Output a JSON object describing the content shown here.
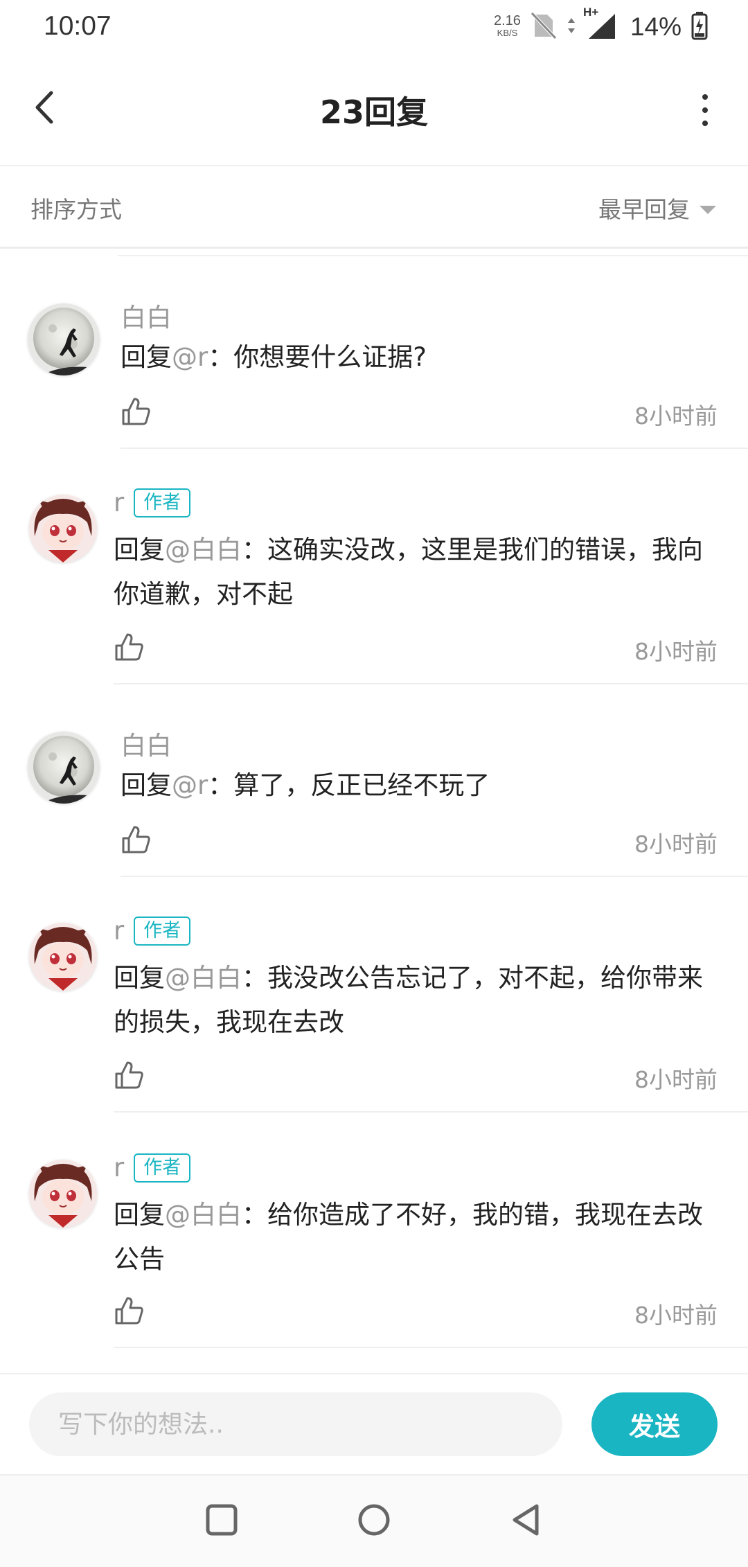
{
  "status_bar": {
    "time": "10:07",
    "net_speed_value": "2.16",
    "net_speed_unit": "KB/S",
    "network_type": "H+",
    "battery_percent": "14%"
  },
  "header": {
    "title": "23回复"
  },
  "sort": {
    "label": "排序方式",
    "selected": "最早回复"
  },
  "replies": [
    {
      "name": "白白",
      "is_author": false,
      "badge": "",
      "reply_prefix": "回复",
      "mention": "@r",
      "text": "：你想要什么证据?",
      "time": "8小时前"
    },
    {
      "name": "r",
      "is_author": true,
      "badge": "作者",
      "reply_prefix": "回复",
      "mention": "@白白",
      "text": "：这确实没改，这里是我们的错误，我向你道歉，对不起",
      "time": "8小时前"
    },
    {
      "name": "白白",
      "is_author": false,
      "badge": "",
      "reply_prefix": "回复",
      "mention": "@r",
      "text": "：算了，反正已经不玩了",
      "time": "8小时前"
    },
    {
      "name": "r",
      "is_author": true,
      "badge": "作者",
      "reply_prefix": "回复",
      "mention": "@白白",
      "text": "：我没改公告忘记了，对不起，给你带来的损失，我现在去改",
      "time": "8小时前"
    },
    {
      "name": "r",
      "is_author": true,
      "badge": "作者",
      "reply_prefix": "回复",
      "mention": "@白白",
      "text": "：给你造成了不好，我的错，我现在去改公告",
      "time": "8小时前"
    }
  ],
  "input": {
    "placeholder": "写下你的想法..",
    "value": ""
  },
  "send_button": {
    "label": "发送"
  },
  "colors": {
    "accent": "#19b5c2",
    "muted_text": "#999999",
    "body_text": "#222222"
  },
  "icons": {
    "back": "chevron-left-icon",
    "more": "more-vertical-icon",
    "like": "thumbs-up-icon",
    "nav_recent": "square-icon",
    "nav_home": "circle-icon",
    "nav_back": "triangle-back-icon"
  }
}
